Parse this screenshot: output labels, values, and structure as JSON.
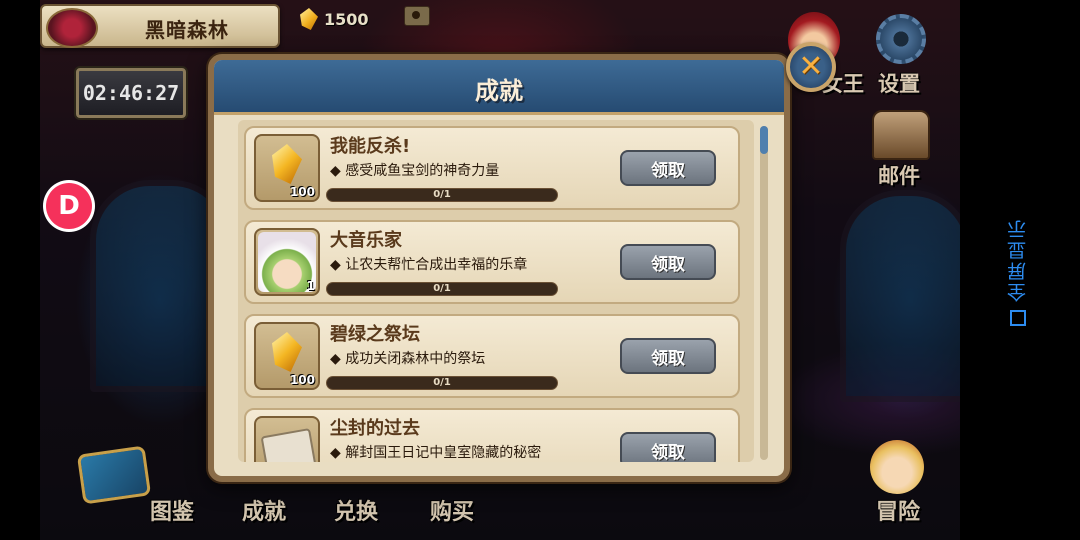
{
  "location": {
    "name": "黑暗森林"
  },
  "currency": {
    "value": "1500",
    "icon": "gem-icon"
  },
  "timer": "02:46:27",
  "side_badge": {
    "icon": "d-logo-icon"
  },
  "top_menu": {
    "king_label": "女王",
    "settings_label": "设置",
    "mail_label": "邮件"
  },
  "bottom_menu": {
    "atlas": "图鉴",
    "achievements": "成就",
    "exchange": "兑换",
    "shop": "购买",
    "adventure": "冒险"
  },
  "dialog": {
    "title": "成就",
    "close_icon": "close-icon",
    "items": [
      {
        "title": "我能反杀!",
        "desc": "◆ 感受咸鱼宝剑的神奇力量",
        "reward_count": "100",
        "progress_text": "0/1",
        "progress": 0,
        "button": "领取",
        "icon": "gem-icon"
      },
      {
        "title": "大音乐家",
        "desc": "◆ 让农夫帮忙合成出幸福的乐章",
        "reward_count": "1",
        "progress_text": "0/1",
        "progress": 0,
        "button": "领取",
        "icon": "character-avatar-icon"
      },
      {
        "title": "碧绿之祭坛",
        "desc": "◆ 成功关闭森林中的祭坛",
        "reward_count": "100",
        "progress_text": "0/1",
        "progress": 0,
        "button": "领取",
        "icon": "gem-icon"
      },
      {
        "title": "尘封的过去",
        "desc": "◆ 解封国王日记中皇室隐藏的秘密",
        "reward_count": "",
        "progress_text": "",
        "progress": 0,
        "button": "领取",
        "icon": "scroll-icon"
      }
    ]
  },
  "fullscreen": {
    "label": "全屏显示",
    "icon": "expand-icon"
  },
  "colors": {
    "dialog_header": "#264b72",
    "accent_link": "#2d8cf0",
    "badge": "#f5315b"
  }
}
